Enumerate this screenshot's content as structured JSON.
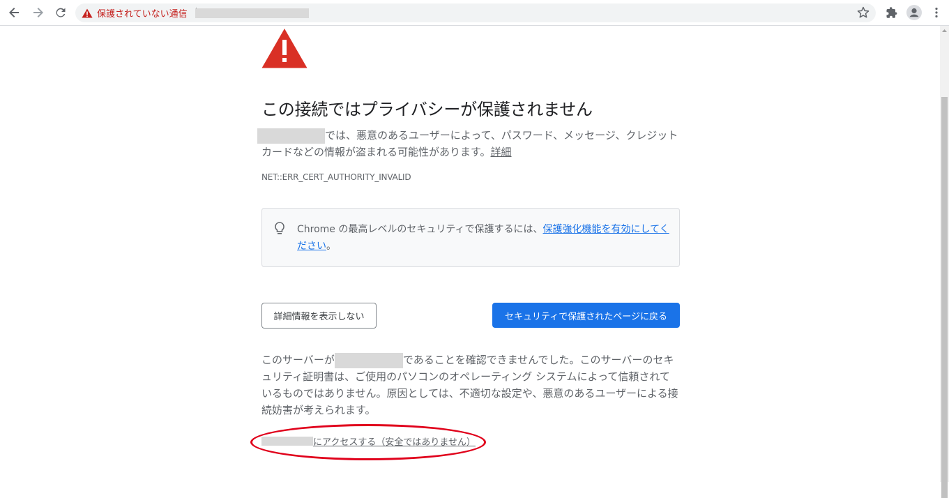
{
  "toolbar": {
    "back_icon": "arrow-left-icon",
    "forward_icon": "arrow-right-icon",
    "reload_icon": "reload-icon",
    "security_chip_label": "保護されていない通信",
    "bookmark_icon": "star-icon",
    "extensions_icon": "puzzle-icon",
    "profile_icon": "avatar-icon",
    "menu_icon": "kebab-menu-icon"
  },
  "page": {
    "heading": "この接続ではプライバシーが保護されません",
    "intro_text": "では、悪意のあるユーザーによって、パスワード、メッセージ、クレジット カードなどの情報が盗まれる可能性があります。",
    "intro_link": "詳細",
    "error_code": "NET::ERR_CERT_AUTHORITY_INVALID",
    "tip_text_before": "Chrome の最高レベルのセキュリティで保護するには、",
    "tip_link": "保護強化機能を有効にしてください",
    "tip_text_after": "。",
    "hide_details_button": "詳細情報を表示しない",
    "back_to_safety_button": "セキュリティで保護されたページに戻る",
    "details_prefix": "このサーバーが",
    "details_text": "であることを確認できませんでした。このサーバーのセキュリティ証明書は、ご使用のパソコンのオペレーティング システムによって信頼されているものではありません。原因としては、不適切な設定や、悪意のあるユーザーによる接続妨害が考えられます。",
    "proceed_link": "にアクセスする（安全ではありません）"
  },
  "colors": {
    "warning_red": "#d93025",
    "primary_blue": "#1a73e8",
    "annotation_red": "#e0001b"
  }
}
